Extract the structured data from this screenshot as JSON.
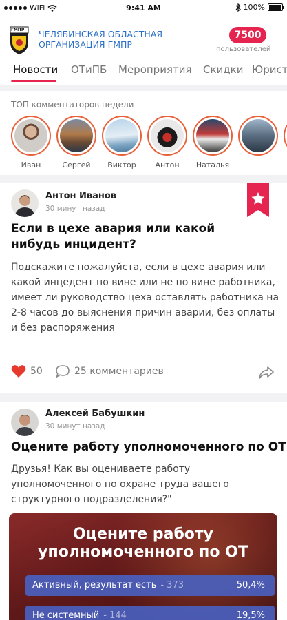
{
  "status": {
    "carrier": "WiFi",
    "time": "9:41 AM",
    "battery": "100%"
  },
  "org": {
    "name": "ЧЕЛЯБИНСКАЯ ОБЛАСТНАЯ ОРГАНИЗАЦИЯ ГМПР",
    "logo_text": "ГМПР"
  },
  "users": {
    "count": "7500",
    "label": "пользователей"
  },
  "tabs": [
    {
      "label": "Новости",
      "active": true
    },
    {
      "label": "ОТиПБ"
    },
    {
      "label": "Мероприятия"
    },
    {
      "label": "Скидки"
    },
    {
      "label": "Юрист"
    }
  ],
  "top_commenters": {
    "title": "ТОП комментаторов недели",
    "items": [
      {
        "name": "Иван"
      },
      {
        "name": "Сергей"
      },
      {
        "name": "Виктор"
      },
      {
        "name": "Антон"
      },
      {
        "name": "Наталья"
      },
      {
        "name": ""
      }
    ]
  },
  "posts": [
    {
      "author": "Антон Иванов",
      "time": "30 минут назад",
      "title": "Если в цехе авария или какой нибудь инцидент?",
      "text": "Подскажите пожалуйста, если в цехе авария или какой инцедент по вине или не по вине работника, имеет ли руководство цеха оставлять работника на 2-8 часов до выяснения причин аварии, без оплаты и без распоряжения",
      "likes": "50",
      "comments": "25 комментариев"
    },
    {
      "author": "Алексей Бабушкин",
      "time": "30 минут назад",
      "title": "Оцените работу уполномоченного по ОТ",
      "text": "Друзья! Как вы оцениваете работу уполномоченного по охране труда вашего структурного подразделения?\"",
      "poll": {
        "title": "Оцените работу уполномоченного по ОТ",
        "options": [
          {
            "label": "Активный, результат есть",
            "count": "- 373",
            "percent": "50,4%"
          },
          {
            "label": "Не системный",
            "count": "- 144",
            "percent": "19,5%"
          }
        ]
      }
    }
  ],
  "colors": {
    "accent": "#e5254f",
    "link": "#2a6fc7",
    "ring": "#e8613a",
    "poll_bar": "#4a60be"
  }
}
